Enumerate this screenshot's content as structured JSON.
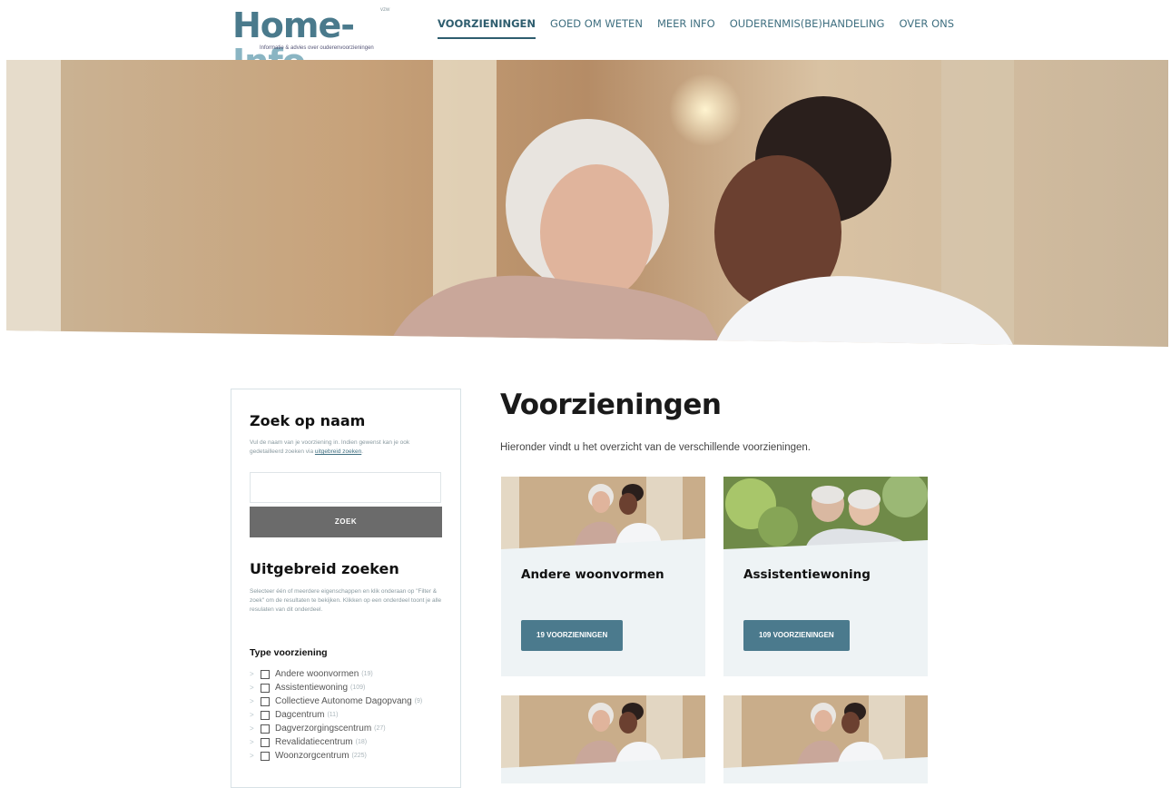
{
  "logo": {
    "brand": "Home-Info",
    "brand_part1": "Home-",
    "brand_part2": "Info",
    "badge": "vzw",
    "tagline": "Informatie & advies over ouderenvoorzieningen"
  },
  "nav": {
    "items": [
      {
        "label": "VOORZIENINGEN",
        "active": true
      },
      {
        "label": "GOED OM WETEN",
        "active": false
      },
      {
        "label": "MEER INFO",
        "active": false
      },
      {
        "label": "OUDERENMIS(BE)HANDELING",
        "active": false
      },
      {
        "label": "OVER ONS",
        "active": false
      }
    ]
  },
  "sidebar": {
    "search_title": "Zoek op naam",
    "search_help": "Vul de naam van je voorziening in. Indien gewenst kan je ook gedetailleerd zoeken via",
    "search_help_link": "uitgebreid zoeken",
    "search_help_end": ".",
    "search_placeholder": "",
    "search_button": "ZOEK",
    "advanced_title": "Uitgebreid zoeken",
    "advanced_help": "Selecteer één of meerdere eigenschappen en klik onderaan op \"Filter & zoek\" om de resultaten te bekijken. Klikken op een onderdeel toont je alle resulaten van dit onderdeel.",
    "filter_heading": "Type voorziening",
    "filters": [
      {
        "label": "Andere woonvormen",
        "count": "(19)"
      },
      {
        "label": "Assistentiewoning",
        "count": "(109)"
      },
      {
        "label": "Collectieve Autonome Dagopvang",
        "count": "(9)"
      },
      {
        "label": "Dagcentrum",
        "count": "(11)"
      },
      {
        "label": "Dagverzorgingscentrum",
        "count": "(27)"
      },
      {
        "label": "Revalidatiecentrum",
        "count": "(18)"
      },
      {
        "label": "Woonzorgcentrum",
        "count": "(225)"
      }
    ]
  },
  "main": {
    "title": "Voorzieningen",
    "intro": "Hieronder vindt u het overzicht van de verschillende voorzieningen.",
    "cards": [
      {
        "title": "Andere woonvormen",
        "button": "19 VOORZIENINGEN"
      },
      {
        "title": "Assistentiewoning",
        "button": "109 VOORZIENINGEN"
      },
      {
        "title": "",
        "button": ""
      },
      {
        "title": "",
        "button": ""
      }
    ]
  },
  "colors": {
    "accent": "#4b7a8d",
    "nav_text": "#3f6f80",
    "card_bg": "#eef3f5",
    "search_button": "#6b6b6b"
  }
}
